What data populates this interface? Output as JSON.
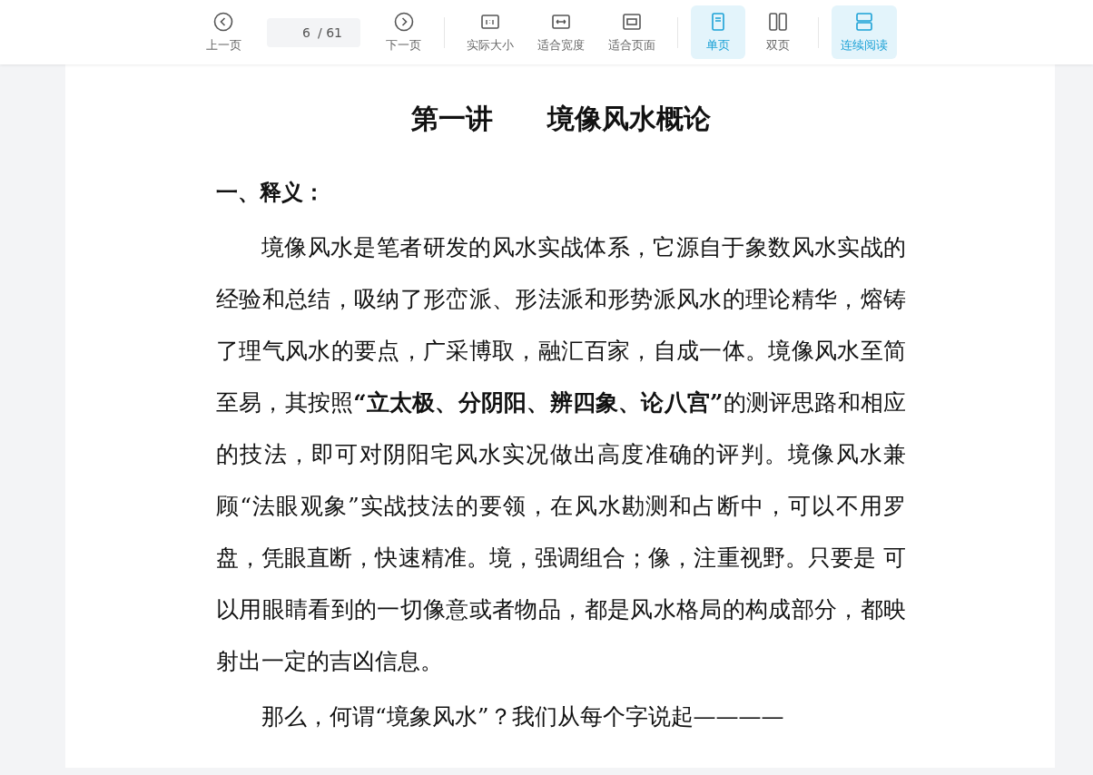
{
  "toolbar": {
    "prev": {
      "label": "上一页"
    },
    "page_field": {
      "value": "6",
      "total": "/ 61"
    },
    "next": {
      "label": "下一页"
    },
    "zoom_buttons": [
      {
        "label": "实际大小",
        "kind": "actual"
      },
      {
        "label": "适合宽度",
        "kind": "width"
      },
      {
        "label": "适合页面",
        "kind": "page"
      }
    ],
    "view_modes": [
      {
        "label": "单页",
        "kind": "single",
        "selected": true
      },
      {
        "label": "双页",
        "kind": "double",
        "selected": false
      }
    ],
    "continuous": {
      "label": "连续阅读",
      "on": true
    }
  },
  "document": {
    "title": "第一讲　　境像风水概论",
    "heading": "一、释义：",
    "paragraphs": [
      "境像风水是笔者研发的风水实战体系，它源自于象数风水实战的经验和总结，吸纳了形峦派、形法派和形势派风水的理论精华，熔铸了理气风水的要点，广采博取，融汇百家，自成一体。境像风水至简至易，其按照**“立太极、分阴阳、辨四象、论八宫”**的测评思路和相应的技法，即可对阴阳宅风水实况做出高度准确的评判。境像风水兼顾“法眼观象”实战技法的要领，在风水勘测和占断中，可以不用罗盘，凭眼直断，快速精准。境，强调组合；像，注重视野。只要是 可以用眼睛看到的一切像意或者物品，都是风水格局的构成部分，都映射出一定的吉凶信息。",
      "那么，何谓“境象风水”？我们从每个字说起————"
    ]
  }
}
